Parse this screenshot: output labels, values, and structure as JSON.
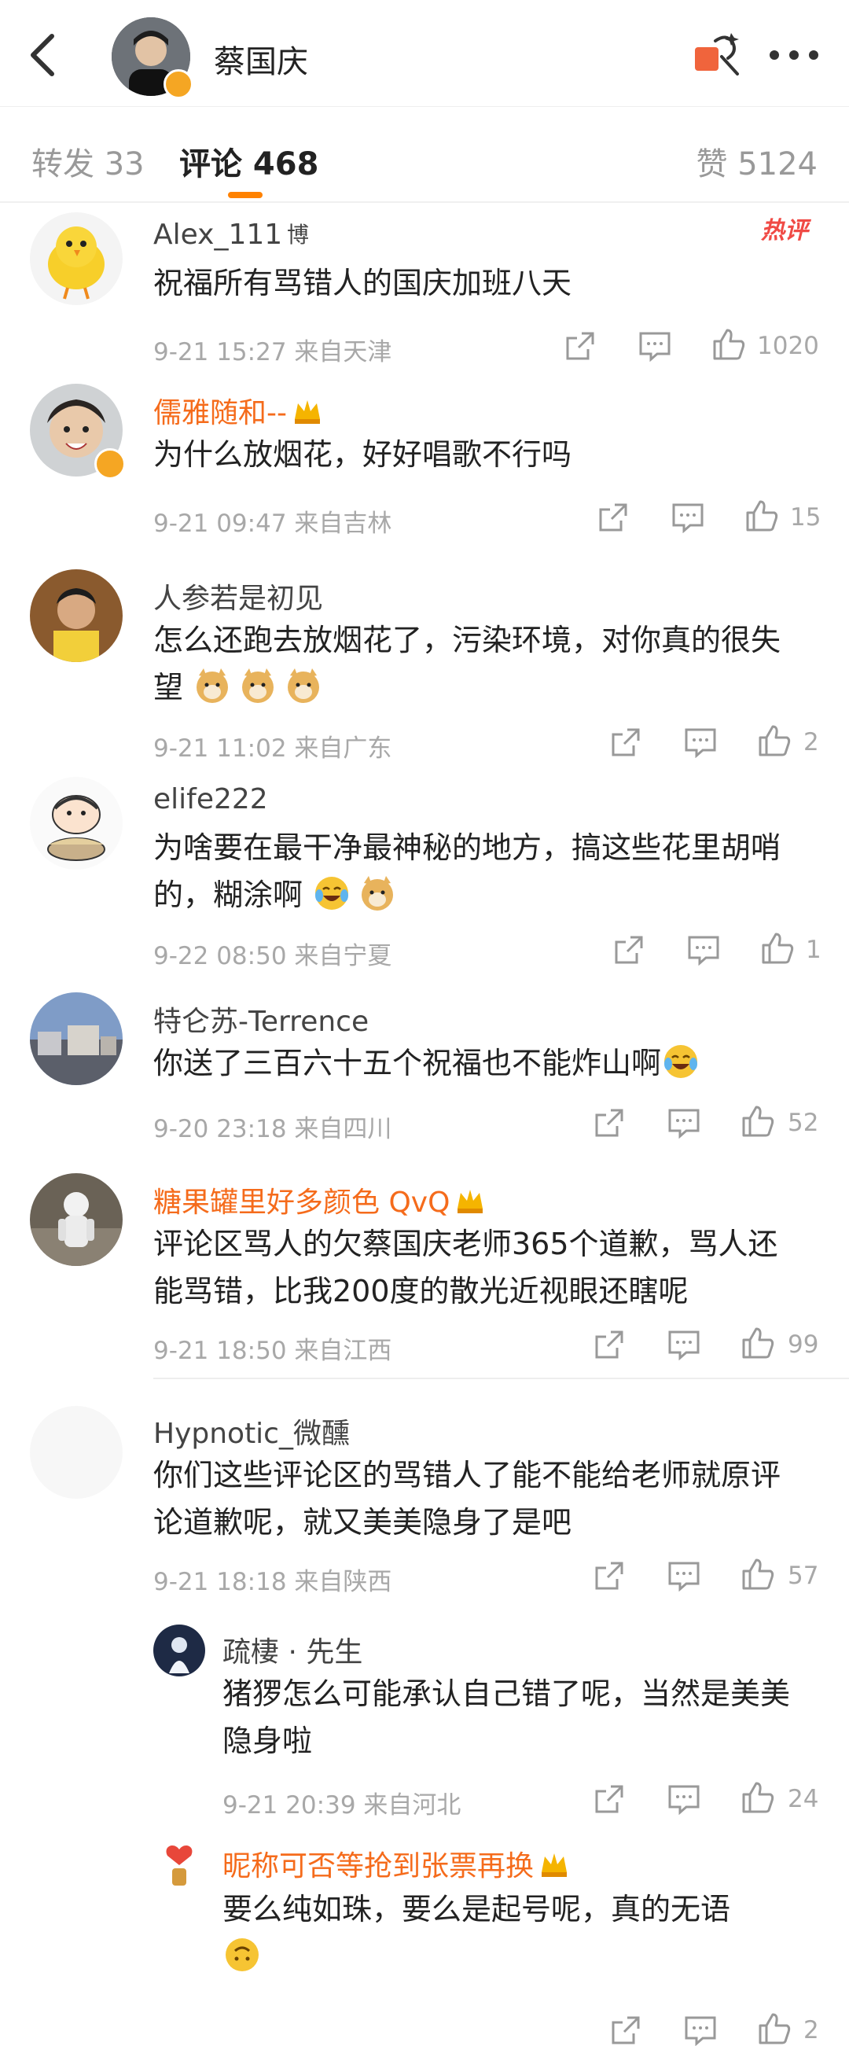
{
  "header": {
    "title": "蔡国庆"
  },
  "tabs": {
    "repost": "转发 33",
    "comment": "评论 468",
    "like": "赞 5124"
  },
  "hot_badge": "热评",
  "comments": [
    {
      "name": "Alex_111",
      "text": "祝福所有骂错人的国庆加班八天",
      "time": "9-21 15:27",
      "location": "来自天津",
      "likes": "1020"
    },
    {
      "name": "儒雅随和--",
      "text": "为什么放烟花，好好唱歌不行吗",
      "time": "9-21 09:47",
      "location": "来自吉林",
      "likes": "15"
    },
    {
      "name": "人参若是初见",
      "text": "怎么还跑去放烟花了，污染环境，对你真的很失望",
      "time": "9-21 11:02",
      "location": "来自广东",
      "likes": "2"
    },
    {
      "name": "elife222",
      "text": "为啥要在最干净最神秘的地方，搞这些花里胡哨的，糊涂啊",
      "time": "9-22 08:50",
      "location": "来自宁夏",
      "likes": "1"
    },
    {
      "name": "特仑苏-Terrence",
      "text": "你送了三百六十五个祝福也不能炸山啊",
      "time": "9-20 23:18",
      "location": "来自四川",
      "likes": "52"
    },
    {
      "name": "糖果罐里好多颜色 QvQ",
      "text": "评论区骂人的欠蔡国庆老师365个道歉，骂人还能骂错，比我200度的散光近视眼还瞎呢",
      "time": "9-21 18:50",
      "location": "来自江西",
      "likes": "99"
    },
    {
      "name": "Hypnotic_微醺",
      "text": "你们这些评论区的骂错人了能不能给老师就原评论道歉呢，就又美美隐身了是吧",
      "time": "9-21 18:18",
      "location": "来自陕西",
      "likes": "57"
    }
  ],
  "replies": [
    {
      "name": "疏棲 · 先生",
      "text": "猪猡怎么可能承认自己错了呢，当然是美美隐身啦",
      "time": "9-21 20:39",
      "location": "来自河北",
      "likes": "24"
    },
    {
      "name": "昵称可否等抢到张票再换",
      "text": "要么纯如珠，要么是起号呢，真的无语",
      "time": "",
      "location": "",
      "likes": "2"
    }
  ],
  "colors": {
    "accent": "#ff8200",
    "vip_name": "#f56b1b",
    "hot": "#f04a45",
    "meta": "#a8a8a8"
  }
}
